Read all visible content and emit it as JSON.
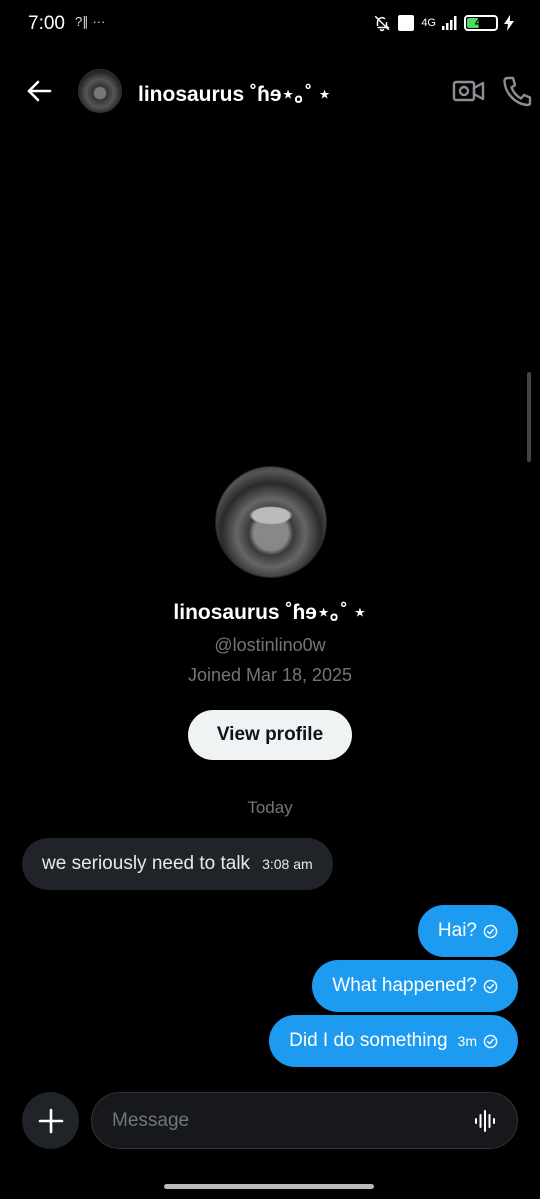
{
  "status_bar": {
    "time": "7:00",
    "left_icons": "?∥ ···",
    "network": "4G",
    "battery": "41"
  },
  "header": {
    "title": "linosaurus ˚ɦɘ⋆｡˚ ⋆"
  },
  "profile": {
    "name": "linosaurus ˚ɦɘ⋆｡˚ ⋆",
    "handle": "@lostinlino0w",
    "joined": "Joined Mar 18, 2025",
    "view_profile_label": "View profile"
  },
  "conversation": {
    "date_separator": "Today",
    "messages": [
      {
        "direction": "incoming",
        "text": "we seriously need to talk",
        "time": "3:08 am"
      },
      {
        "direction": "outgoing",
        "text": "Hai?",
        "time": ""
      },
      {
        "direction": "outgoing",
        "text": "What happened?",
        "time": ""
      },
      {
        "direction": "outgoing",
        "text": "Did I do something",
        "time": "3m"
      }
    ]
  },
  "composer": {
    "placeholder": "Message"
  },
  "colors": {
    "accent": "#1d9bf0",
    "background": "#000000",
    "incoming_bubble": "#202327"
  },
  "icons": [
    "back-arrow-icon",
    "video-camera-icon",
    "phone-icon",
    "plus-icon",
    "voice-waveform-icon",
    "sent-check-icon",
    "mute-bell-icon",
    "battery-icon"
  ]
}
